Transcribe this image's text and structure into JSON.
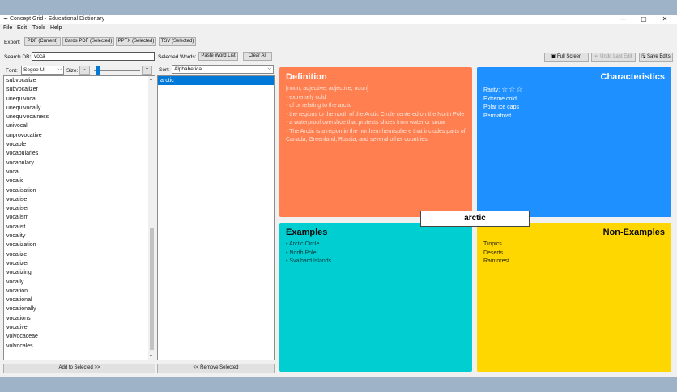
{
  "window": {
    "title": "Concept Grid - Educational Dictionary",
    "minimize": "—",
    "maximize": "▢",
    "close": "✕"
  },
  "menu": [
    "File",
    "Edit",
    "Tools",
    "Help"
  ],
  "export": {
    "label": "Export:",
    "buttons": [
      "PDF (Current)",
      "Cards PDF (Selected)",
      "PPTX (Selected)",
      "TSV (Selected)"
    ]
  },
  "search": {
    "label": "Search DB:",
    "value": "voca"
  },
  "font": {
    "label": "Font:",
    "value": "Segoe UI",
    "size_label": "Size:",
    "dec": "-",
    "inc": "+",
    "size_level": 0.05
  },
  "selected_words": {
    "label": "Selected Words:",
    "paste_button": "Paste Word List",
    "clear_button": "Clear All",
    "sort_label": "Sort:",
    "sort_value": "Alphabetical",
    "items": [
      "arctic"
    ]
  },
  "word_list": [
    "subvocalize",
    "subvocalizer",
    "unequivocal",
    "unequivocally",
    "unequivocalness",
    "univocal",
    "unprovocative",
    "vocable",
    "vocabularies",
    "vocabulary",
    "vocal",
    "vocalic",
    "vocalisation",
    "vocalise",
    "vocaliser",
    "vocalism",
    "vocalist",
    "vocality",
    "vocalization",
    "vocalize",
    "vocalizer",
    "vocalizing",
    "vocally",
    "vocation",
    "vocational",
    "vocationally",
    "vocations",
    "vocative",
    "volvocaceae",
    "volvocales"
  ],
  "bottom_buttons": {
    "add": "Add to Selected >>",
    "remove": "<< Remove Selected"
  },
  "toolbar": {
    "full_screen": "Full Screen",
    "undo": "↩ Undo Last Edit",
    "save": "Save Edits"
  },
  "grid": {
    "word": "arctic",
    "definition": {
      "title": "Definition",
      "color": "#ff7f50",
      "lines": [
        "[noun, adjective, adjective, noun]",
        "- extremely cold",
        "- of or relating to the arctic",
        "- the regions to the north of the Arctic Circle centered on the North Pole",
        "- a waterproof overshoe that protects shoes from water or snow",
        "- The Arctic is a region in the northern hemisphere that includes parts of Canada, Greenland, Russia, and several other countries."
      ]
    },
    "characteristics": {
      "title": "Characteristics",
      "color": "#1e90ff",
      "rarity_label": "Rarity:",
      "rarity_stars": "☆☆☆",
      "items": [
        "Extreme cold",
        "Polar ice caps",
        "Permafrost"
      ]
    },
    "examples": {
      "title": "Examples",
      "color": "#00ced1",
      "items": [
        "• Arctic Circle",
        "• North Pole",
        "• Svalbard Islands"
      ]
    },
    "non_examples": {
      "title": "Non-Examples",
      "color": "#ffd700",
      "items": [
        "Tropics",
        "Deserts",
        "Rainforest"
      ]
    }
  }
}
